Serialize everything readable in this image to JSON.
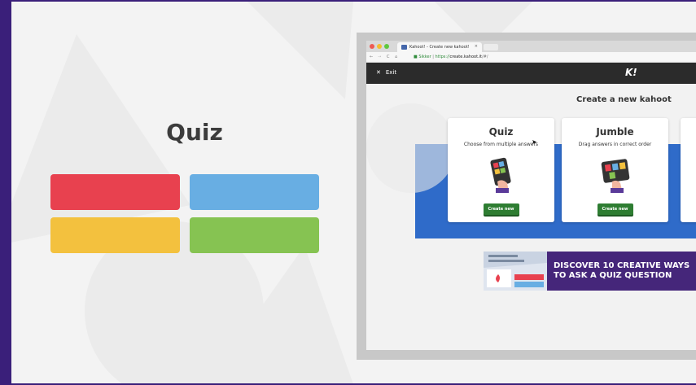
{
  "left_panel": {
    "title": "Quiz",
    "answer_colors": [
      "#e8414f",
      "#68aee3",
      "#f3c13e",
      "#86c352"
    ]
  },
  "browser": {
    "tab_title": "Kahoot! - Create new kahoot!",
    "tab_close": "×",
    "secure_label": "Sikker",
    "url_scheme": "https://",
    "url_host": "create.kahoot.it",
    "url_path": "/#/"
  },
  "kahoot": {
    "exit_label": "Exit",
    "logo": "K!",
    "page_heading": "Create a new kahoot",
    "cards": [
      {
        "title": "Quiz",
        "description": "Choose from multiple answers",
        "button": "Create new"
      },
      {
        "title": "Jumble",
        "description": "Drag answers in correct order",
        "button": "Create new"
      }
    ],
    "promo": {
      "line1": "DISCOVER 10 CREATIVE WAYS",
      "line2": "TO ASK A QUIZ QUESTION"
    }
  }
}
